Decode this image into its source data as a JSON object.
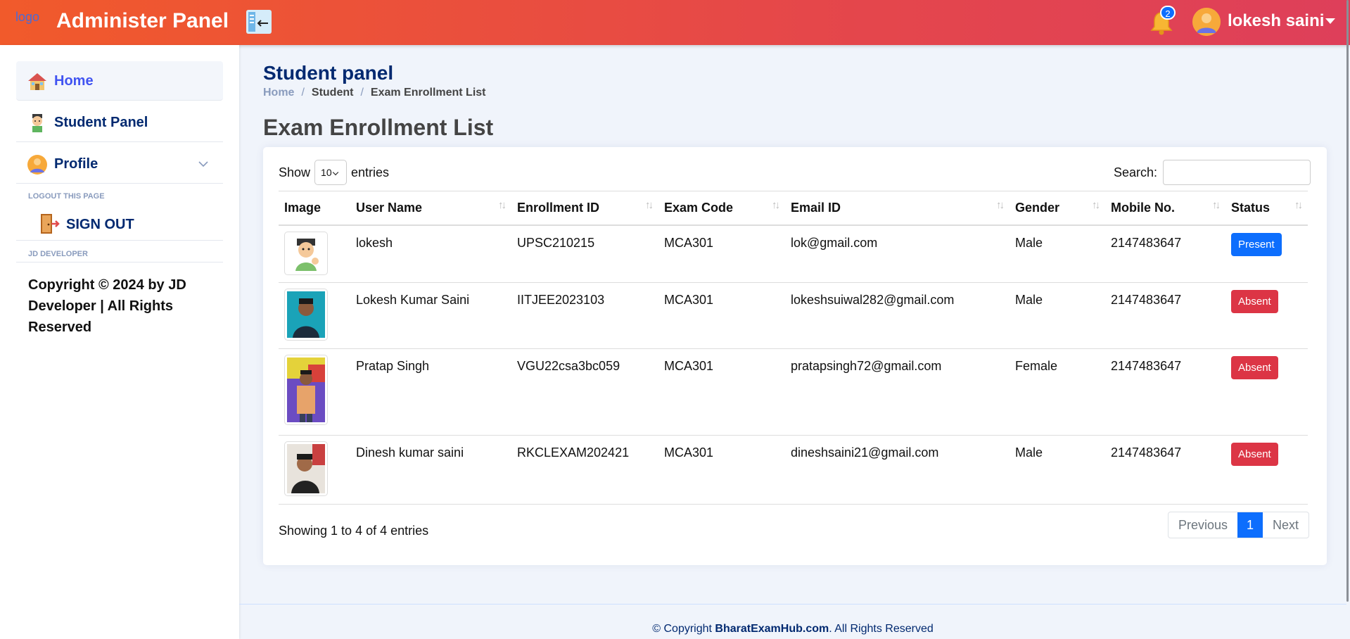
{
  "header": {
    "logo_text": "logo",
    "brand": "Administer Panel",
    "notification_count": "2",
    "user_name": "lokesh saini"
  },
  "sidebar": {
    "items": [
      {
        "label": "Home",
        "icon": "house-icon"
      },
      {
        "label": "Student Panel",
        "icon": "student-icon"
      },
      {
        "label": "Profile",
        "icon": "user-avatar-icon"
      }
    ],
    "logout_heading": "LOGOUT THIS PAGE",
    "signout_label": "SIGN OUT",
    "dev_heading": "JD DEVELOPER",
    "copyright": "Copyright © 2024 by JD Developer | All Rights Reserved"
  },
  "page": {
    "title": "Student panel",
    "breadcrumb": [
      "Home",
      "/",
      "Student",
      "/",
      "Exam Enrollment List"
    ],
    "heading": "Exam Enrollment List"
  },
  "table_controls": {
    "show_label": "Show",
    "entries_value": "10",
    "entries_label": "entries",
    "search_label": "Search:"
  },
  "table": {
    "columns": [
      "Image",
      "User Name",
      "Enrollment ID",
      "Exam Code",
      "Email ID",
      "Gender",
      "Mobile No.",
      "Status"
    ],
    "rows": [
      {
        "user": "lokesh",
        "enrollment": "UPSC210215",
        "exam": "MCA301",
        "email": "lok@gmail.com",
        "gender": "Male",
        "mobile": "2147483647",
        "status": "Present"
      },
      {
        "user": "Lokesh Kumar Saini",
        "enrollment": "IITJEE2023103",
        "exam": "MCA301",
        "email": "lokeshsuiwal282@gmail.com",
        "gender": "Male",
        "mobile": "2147483647",
        "status": "Absent"
      },
      {
        "user": "Pratap Singh",
        "enrollment": "VGU22csa3bc059",
        "exam": "MCA301",
        "email": "pratapsingh72@gmail.com",
        "gender": "Female",
        "mobile": "2147483647",
        "status": "Absent"
      },
      {
        "user": "Dinesh kumar saini",
        "enrollment": "RKCLEXAM202421",
        "exam": "MCA301",
        "email": "dineshsaini21@gmail.com",
        "gender": "Male",
        "mobile": "2147483647",
        "status": "Absent"
      }
    ]
  },
  "table_footer": {
    "info": "Showing 1 to 4 of 4 entries",
    "prev": "Previous",
    "page": "1",
    "next": "Next"
  },
  "footer": {
    "prefix": "© Copyright ",
    "site": "BharatExamHub.com",
    "suffix": ". All Rights Reserved"
  },
  "colors": {
    "header_start": "#f15a2b",
    "header_end": "#de3f5a",
    "nav_text": "#012970",
    "active_nav": "#4154f1",
    "present": "#0d6efd",
    "absent": "#dc3545"
  }
}
